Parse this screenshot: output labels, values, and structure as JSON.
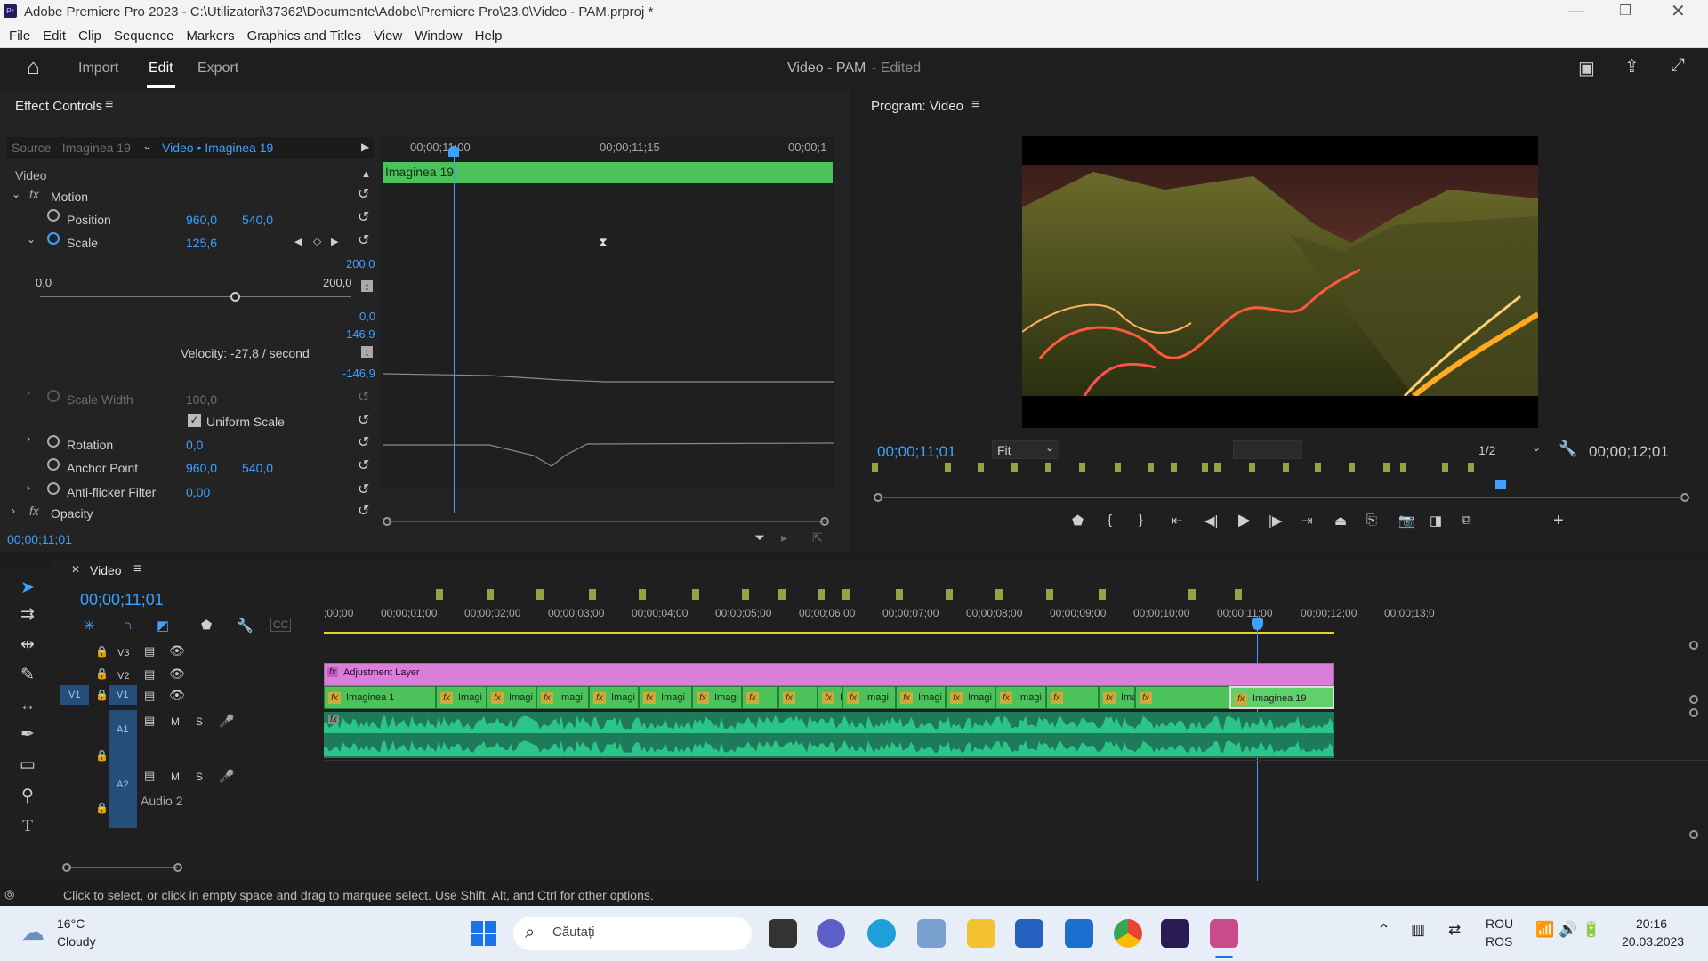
{
  "window": {
    "title": "Adobe Premiere Pro 2023 - C:\\Utilizatori\\37362\\Documente\\Adobe\\Premiere Pro\\23.0\\Video - PAM.prproj *",
    "app_icon": "Pr"
  },
  "menu": [
    "File",
    "Edit",
    "Clip",
    "Sequence",
    "Markers",
    "Graphics and Titles",
    "View",
    "Window",
    "Help"
  ],
  "header": {
    "tabs": [
      "Import",
      "Edit",
      "Export"
    ],
    "active_tab": "Edit",
    "project": "Video - PAM",
    "status": "- Edited"
  },
  "effect_controls": {
    "title": "Effect Controls",
    "source": "Source · Imaginea 19",
    "target": "Video • Imaginea 19",
    "times": [
      "00;00;11;00",
      "00;00;11;15",
      "00;00;1"
    ],
    "clip_name": "Imaginea 19",
    "section": "Video",
    "motion": "Motion",
    "position": {
      "label": "Position",
      "x": "960,0",
      "y": "540,0"
    },
    "scale": {
      "label": "Scale",
      "value": "125,6",
      "min": "0,0",
      "max": "200,0",
      "graph_top": "200,0",
      "graph_zero": "0,0",
      "vel_top": "146,9",
      "vel_bottom": "-146,9",
      "velocity": "Velocity: -27,8 / second"
    },
    "scale_width": {
      "label": "Scale Width",
      "value": "100,0"
    },
    "uniform_scale": "Uniform Scale",
    "rotation": {
      "label": "Rotation",
      "value": "0,0"
    },
    "anchor": {
      "label": "Anchor Point",
      "x": "960,0",
      "y": "540,0"
    },
    "antiflicker": {
      "label": "Anti-flicker Filter",
      "value": "0,00"
    },
    "opacity": "Opacity",
    "timecode": "00;00;11;01"
  },
  "program": {
    "title": "Program: Video",
    "timecode": "00;00;11;01",
    "fit": "Fit",
    "resolution": "1/2",
    "duration": "00;00;12;01"
  },
  "timeline": {
    "title": "Video",
    "timecode": "00;00;11;01",
    "ruler": [
      ";00;00",
      "00;00;01;00",
      "00;00;02;00",
      "00;00;03;00",
      "00;00;04;00",
      "00;00;05;00",
      "00;00;06;00",
      "00;00;07;00",
      "00;00;08;00",
      "00;00;09;00",
      "00;00;10;00",
      "00;00;11;00",
      "00;00;12;00",
      "00;00;13;0"
    ],
    "tracks": {
      "v3": "V3",
      "v2": "V2",
      "v1": "V1",
      "v1_source": "V1",
      "a1": "A1",
      "a2": "A2",
      "m": "M",
      "s": "S",
      "audio2": "Audio 2"
    },
    "adjustment_layer": "Adjustment Layer",
    "clips": [
      "Imaginea 1",
      "Imagi",
      "Imagi",
      "Imagi",
      "Imagi",
      "Imagi",
      "Imagi",
      "",
      "",
      "Imagi",
      "Imagi",
      "Imagi",
      "Imagi",
      "Imagi",
      "",
      "Imaginea",
      "",
      "Imaginea 19"
    ],
    "fx": "fx"
  },
  "status_bar": "Click to select, or click in empty space and drag to marquee select. Use Shift, Alt, and Ctrl for other options.",
  "taskbar": {
    "weather_temp": "16°C",
    "weather_desc": "Cloudy",
    "search": "Căutați",
    "lang1": "ROU",
    "lang2": "ROS",
    "time": "20:16",
    "date": "20.03.2023"
  },
  "colors": {
    "accent": "#3fa0ff",
    "clip_green": "#4cc35a",
    "adjustment": "#d97fd9",
    "audio": "#2bc489",
    "marker": "#8fa540"
  }
}
